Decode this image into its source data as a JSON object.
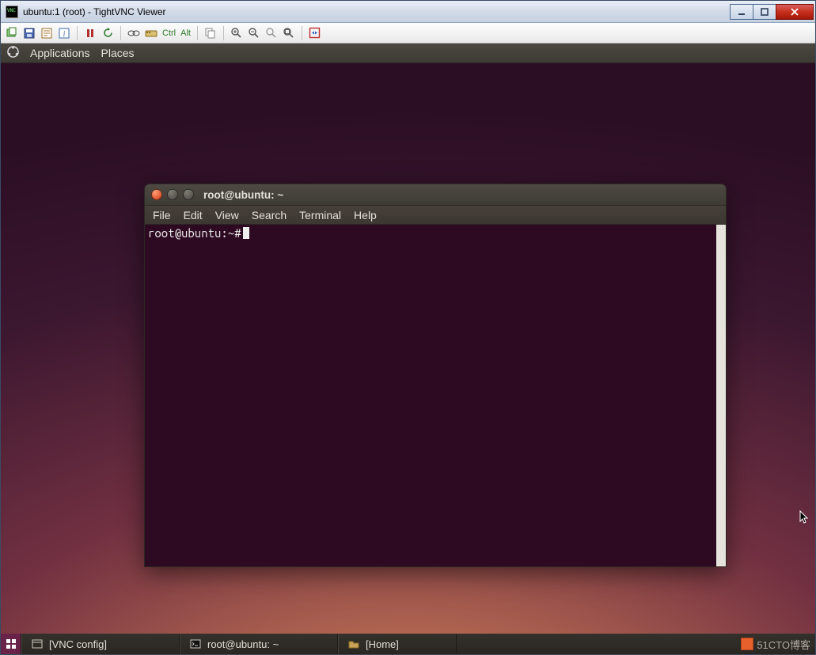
{
  "window": {
    "title": "ubuntu:1 (root) - TightVNC Viewer"
  },
  "vnc_toolbar": {
    "ctrl_label": "Ctrl",
    "alt_label": "Alt"
  },
  "gnome_panel": {
    "applications": "Applications",
    "places": "Places"
  },
  "terminal": {
    "title": "root@ubuntu: ~",
    "menus": {
      "file": "File",
      "edit": "Edit",
      "view": "View",
      "search": "Search",
      "terminal": "Terminal",
      "help": "Help"
    },
    "prompt": "root@ubuntu:~# "
  },
  "taskbar": {
    "items": [
      "[VNC config]",
      "root@ubuntu: ~",
      "[Home]"
    ]
  },
  "watermark": "51CTO博客"
}
